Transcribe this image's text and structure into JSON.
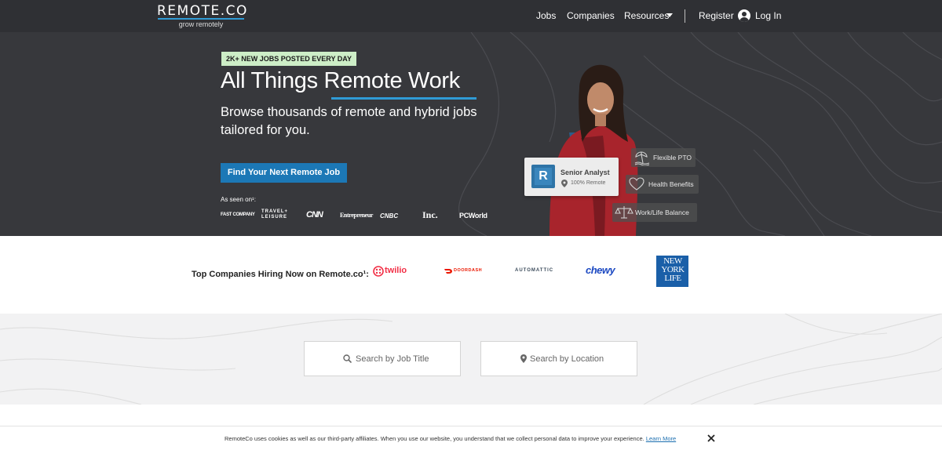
{
  "header": {
    "logo": "REMOTE.CO",
    "tagline": "grow remotely",
    "nav": {
      "jobs": "Jobs",
      "companies": "Companies",
      "resources": "Resources",
      "register": "Register",
      "login": "Log In"
    }
  },
  "hero": {
    "badge": "2K+ NEW JOBS POSTED EVERY DAY",
    "title": "All Things Remote Work",
    "subtitle": "Browse thousands of remote and hybrid jobs tailored for you.",
    "cta": "Find Your Next Remote Job",
    "seen_on": "As seen on¹:",
    "press": [
      "FAST COMPANY",
      "TRAVEL+ LEISURE",
      "CNN",
      "Entrepreneur",
      "CNBC",
      "Inc.",
      "PCWorld"
    ]
  },
  "job_card": {
    "logo_letter": "R",
    "title": "Senior Analyst",
    "location": "100% Remote"
  },
  "perks": [
    "Flexible PTO",
    "Health Benefits",
    "Work/Life Balance"
  ],
  "companies": {
    "label": "Top Companies Hiring Now on Remote.co¹:",
    "logos": [
      "twilio",
      "DOORDASH",
      "AUTOMATTIC",
      "chewy",
      "NEW YORK LIFE"
    ]
  },
  "search": {
    "job_title_placeholder": "Search by Job Title",
    "location_placeholder": "Search by Location"
  },
  "cookie": {
    "text": "RemoteCo uses cookies as well as our third-party affiliates. When you use our website, you understand that we collect personal data to improve your experience.",
    "link": "Learn More"
  },
  "colors": {
    "header_bg": "#2f3034",
    "hero_bg": "#37383c",
    "accent_blue": "#2f9bd6",
    "cta_blue": "#1c78b6",
    "badge_green": "#cdeec7",
    "twilio_red": "#f22f46",
    "doordash_red": "#eb1700",
    "chewy_blue": "#1c49c2",
    "nyl_blue": "#1a5fa8"
  },
  "icons": [
    "user-icon",
    "caret-down-icon",
    "search-icon",
    "location-pin-icon",
    "close-icon",
    "beach-icon",
    "heart-icon",
    "scale-icon"
  ]
}
